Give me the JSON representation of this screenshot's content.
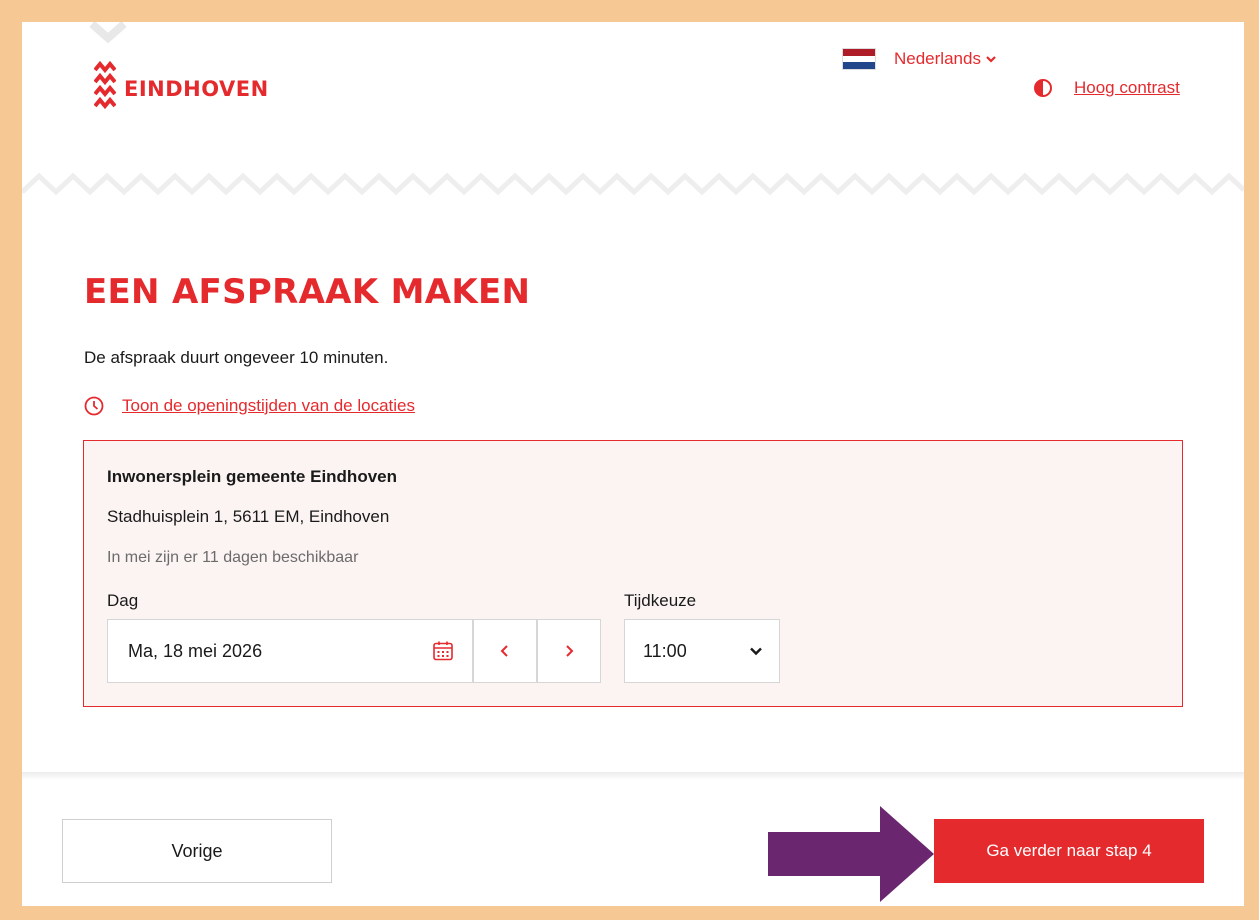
{
  "header": {
    "logo_text": "EINDHOVEN",
    "language": {
      "label": "Nederlands",
      "flag_colors": [
        "#AE1C28",
        "#FFFFFF",
        "#21468B"
      ]
    },
    "contrast_label": "Hoog contrast"
  },
  "main": {
    "title": "EEN AFSPRAAK MAKEN",
    "intro": "De afspraak duurt ongeveer 10 minuten.",
    "hours_link": "Toon de openingstijden van de locaties",
    "location": {
      "name": "Inwonersplein gemeente Eindhoven",
      "address": "Stadhuisplein 1, 5611 EM, Eindhoven",
      "availability": "In mei zijn er 11 dagen beschikbaar",
      "day_label": "Dag",
      "day_value": "Ma, 18 mei 2026",
      "time_label": "Tijdkeuze",
      "time_value": "11:00"
    }
  },
  "footer": {
    "prev_label": "Vorige",
    "next_label": "Ga verder naar stap 4"
  },
  "icons": {
    "logo": "eindhoven-logo-icon",
    "calendar": "calendar-icon",
    "clock": "clock-icon",
    "contrast": "contrast-icon",
    "annotation": "purple-arrow-icon"
  },
  "colors": {
    "accent": "#E52A2E",
    "frame": "#F6C894",
    "box_bg": "#FCF4F3",
    "arrow": "#6B2670"
  }
}
